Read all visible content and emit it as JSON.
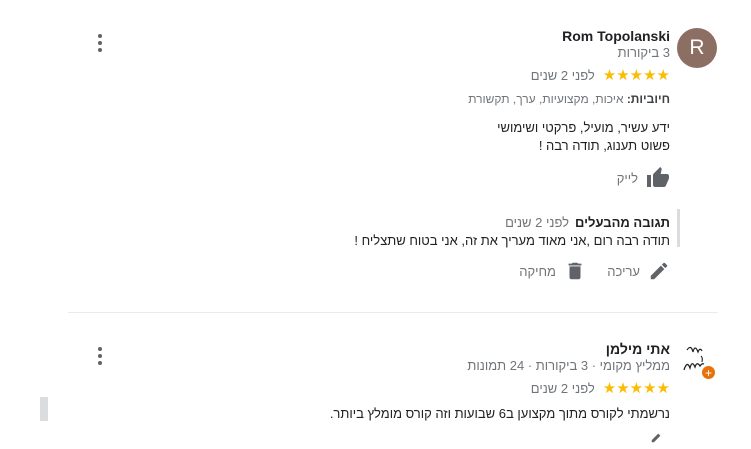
{
  "reviews": [
    {
      "avatar_letter": "R",
      "name": "Rom Topolanski",
      "meta": "3 ביקורות",
      "stars": "★★★★★",
      "date": "לפני 2 שנים",
      "positives_label": "חיוביות:",
      "positives_value": " איכות, מקצועיות, ערך, תקשורת",
      "text_line1": "ידע עשיר, מועיל, פרקטי ושימושי",
      "text_line2": "פשוט תענוג, תודה רבה !",
      "like_label": "לייק",
      "owner_reply": {
        "title": "תגובה מהבעלים",
        "date": "לפני 2 שנים",
        "text": "תודה רבה רום ,אני מאוד מעריך את זה, אני בטוח שתצליח !"
      },
      "edit_label": "עריכה",
      "delete_label": "מחיקה"
    },
    {
      "name": "אתי מילמן",
      "meta": "ממליץ מקומי · 3 ביקורות · 24 תמונות",
      "stars": "★★★★★",
      "date": "לפני 2 שנים",
      "text_line1": "נרשמתי לקורס מתוך מקצוען ב6 שבועות וזה קורס מומלץ ביותר."
    }
  ],
  "colors": {
    "star": "#fbbc04",
    "avatar": "#8d6e63",
    "local_guide_badge": "#e8710a"
  },
  "icons": [
    "more-vert-icon",
    "thumb-up-icon",
    "edit-pencil-icon",
    "delete-trash-icon",
    "local-guide-badge-icon"
  ]
}
